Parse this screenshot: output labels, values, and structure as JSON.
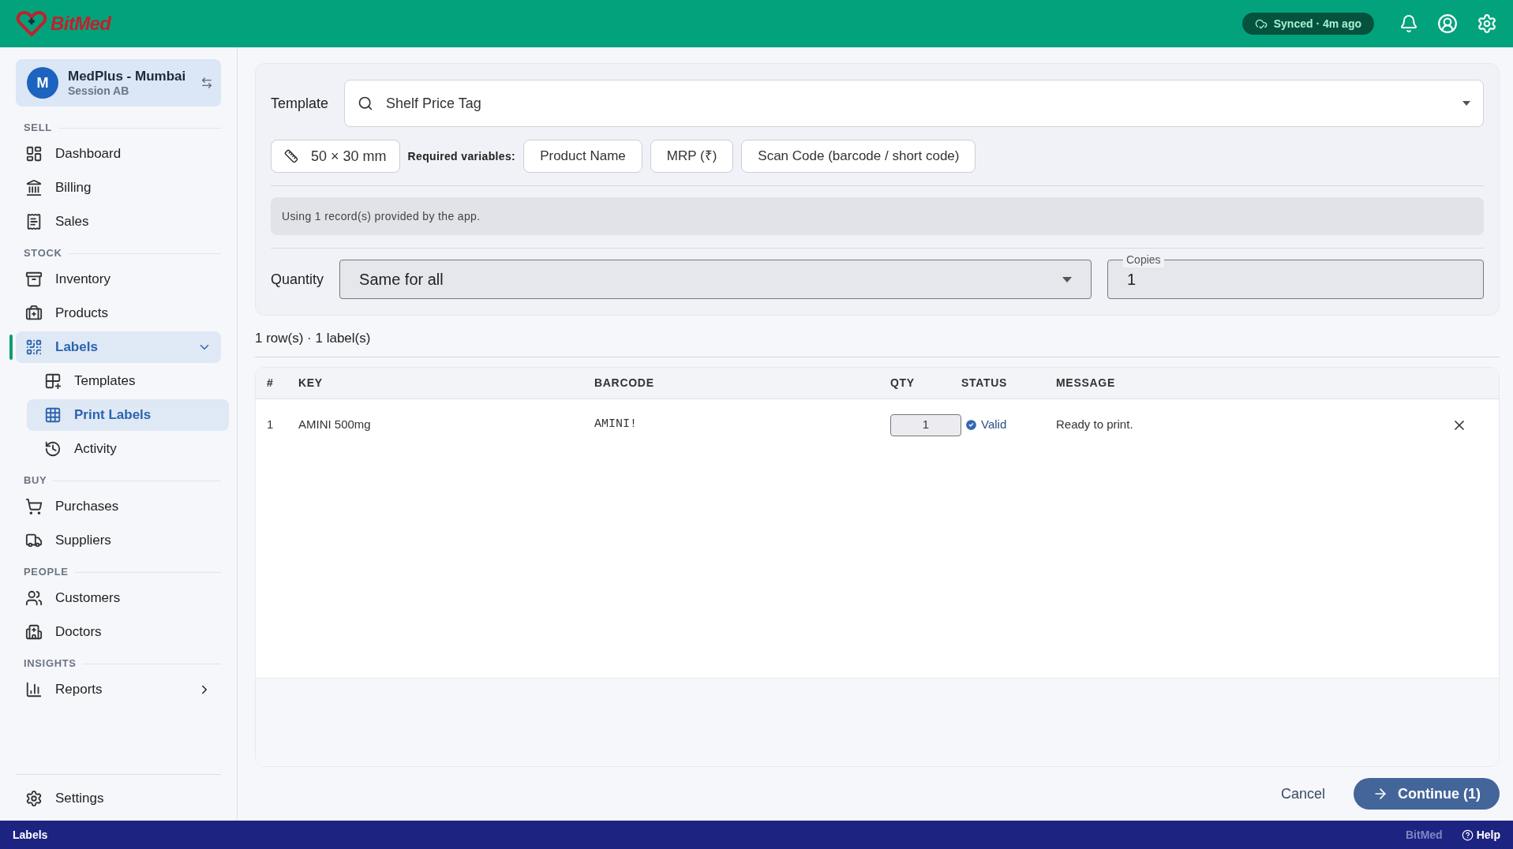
{
  "app": {
    "logo": "BitMed",
    "sync_status": "Synced · 4m ago"
  },
  "store": {
    "avatar": "M",
    "name": "MedPlus - Mumbai",
    "session": "Session AB"
  },
  "sidebar": {
    "sections": [
      {
        "title": "SELL",
        "items": [
          {
            "label": "Dashboard",
            "selected": false
          },
          {
            "label": "Billing",
            "selected": false
          },
          {
            "label": "Sales",
            "selected": false
          }
        ]
      },
      {
        "title": "STOCK",
        "items": [
          {
            "label": "Inventory",
            "selected": false
          },
          {
            "label": "Products",
            "selected": false
          },
          {
            "label": "Labels",
            "selected": true,
            "expanded": true,
            "children": [
              {
                "label": "Templates",
                "selected": false
              },
              {
                "label": "Print Labels",
                "selected": true
              },
              {
                "label": "Activity",
                "selected": false
              }
            ]
          }
        ]
      },
      {
        "title": "BUY",
        "items": [
          {
            "label": "Purchases",
            "selected": false
          },
          {
            "label": "Suppliers",
            "selected": false
          }
        ]
      },
      {
        "title": "PEOPLE",
        "items": [
          {
            "label": "Customers",
            "selected": false
          },
          {
            "label": "Doctors",
            "selected": false
          }
        ]
      },
      {
        "title": "INSIGHTS",
        "items": [
          {
            "label": "Reports",
            "selected": false,
            "expanded": false
          }
        ]
      }
    ],
    "footer_item": {
      "label": "Settings",
      "selected": false
    }
  },
  "template": {
    "label": "Template",
    "value": "Shelf Price Tag",
    "size": "50 × 30 mm",
    "required_label": "Required variables:",
    "variables": [
      "Product Name",
      "MRP (₹)",
      "Scan Code (barcode / short code)"
    ],
    "info": "Using 1 record(s) provided by the app."
  },
  "quantity": {
    "label": "Quantity",
    "mode": "Same for all",
    "copies_label": "Copies",
    "copies": "1"
  },
  "summary": "1 row(s) · 1 label(s)",
  "table": {
    "columns": [
      "#",
      "KEY",
      "BARCODE",
      "QTY",
      "STATUS",
      "MESSAGE"
    ],
    "rows": [
      {
        "index": "1",
        "key": "AMINI 500mg",
        "barcode": "AMINI!",
        "qty": "1",
        "status": "Valid",
        "message": "Ready to print."
      }
    ]
  },
  "actions": {
    "cancel": "Cancel",
    "continue": "Continue (1)"
  },
  "status_bar": {
    "page": "Labels",
    "brand": "BitMed",
    "help": "Help"
  }
}
